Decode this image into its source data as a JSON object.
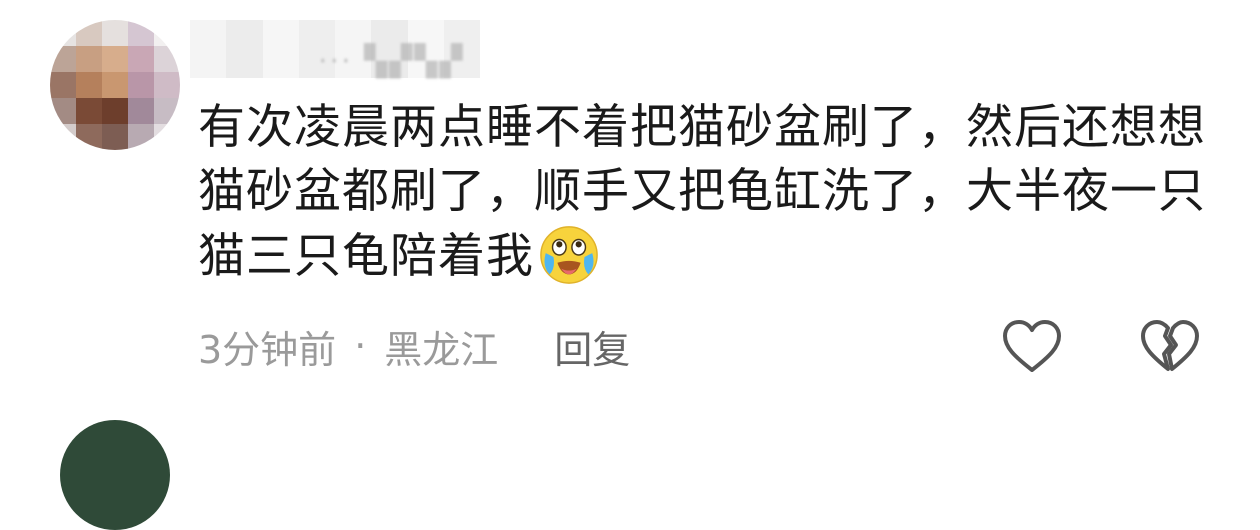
{
  "comment": {
    "text": "有次凌晨两点睡不着把猫砂盆刷了，然后还想想猫砂盆都刷了，顺手又把龟缸洗了，大半夜一只猫三只龟陪着我",
    "emoji_icon": "crying-laughing-emoji",
    "time": "3分钟前",
    "separator": "·",
    "location": "黑龙江",
    "reply_label": "回复",
    "like_icon": "heart-icon",
    "dislike_icon": "broken-heart-icon"
  },
  "colors": {
    "text": "#1a1a1a",
    "meta": "#9a9a9a",
    "reply": "#666666",
    "icon_stroke": "#555555"
  }
}
